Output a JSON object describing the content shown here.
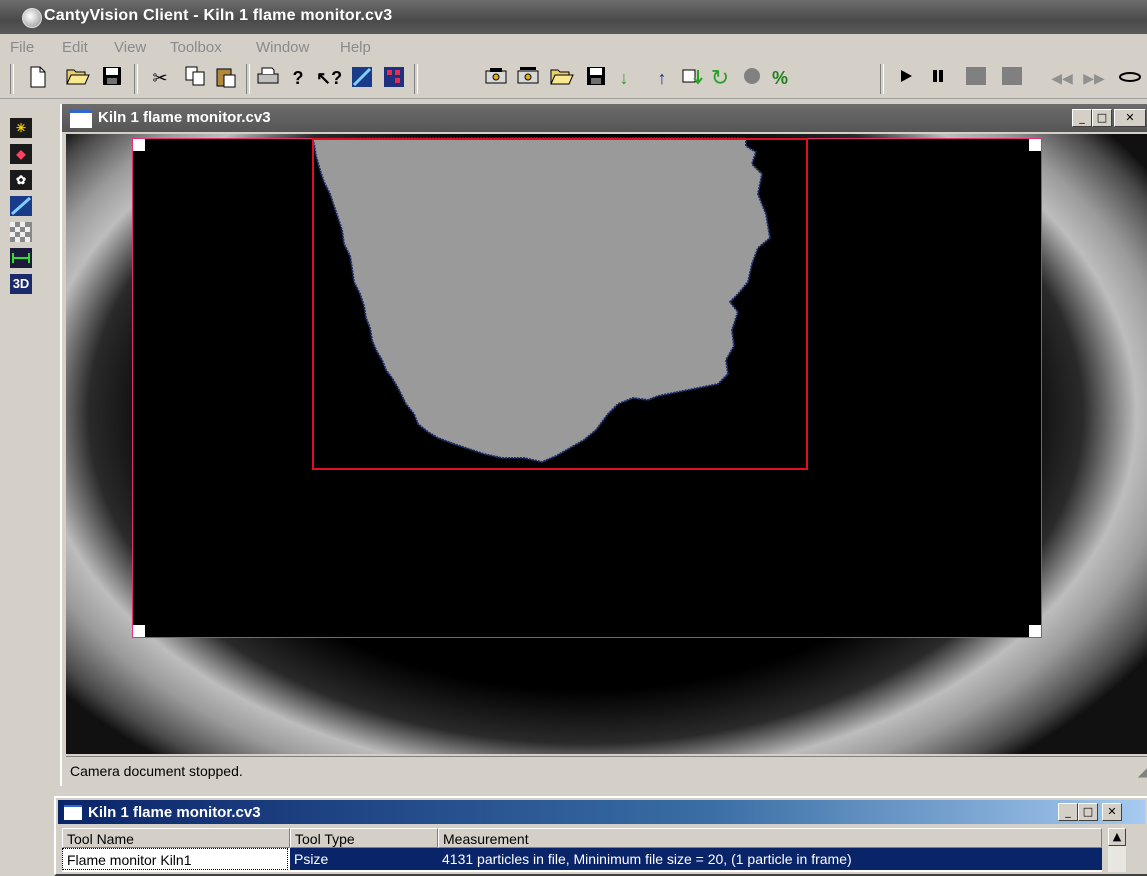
{
  "app": {
    "title": "CantyVision Client - Kiln 1 flame monitor.cv3"
  },
  "menu": [
    "File",
    "Edit",
    "View",
    "Toolbox",
    "Window",
    "Help"
  ],
  "toolbar": {
    "icons": [
      "new-file-icon",
      "open-folder-icon",
      "save-disk-icon",
      "cut-icon",
      "copy-icon",
      "paste-icon",
      "print-icon",
      "help-icon",
      "context-help-icon",
      "wand-icon",
      "pattern-icon",
      "camera-icon",
      "camera-open-icon",
      "open-folder-icon",
      "save-disk-icon",
      "arrow-down-icon",
      "arrow-up-icon",
      "download-icon",
      "refresh-icon",
      "record-icon",
      "percent-icon",
      "play-icon",
      "pause-icon",
      "stop-icon",
      "stop-icon",
      "rewind-icon",
      "fast-forward-icon",
      "loop-icon"
    ],
    "percent_label": "%"
  },
  "left_toolbar": {
    "three_d_label": "3D"
  },
  "document": {
    "title": "Kiln 1 flame monitor.cv3",
    "status": "Camera document stopped."
  },
  "panel": {
    "title": "Kiln 1 flame monitor.cv3",
    "columns": [
      "Tool Name",
      "Tool Type",
      "Measurement"
    ],
    "rows": [
      {
        "tool_name": "Flame monitor Kiln1",
        "tool_type": "Psize",
        "measurement": "4131 particles in file, Mininimum file size = 20, (1 particle in frame)"
      }
    ]
  },
  "colors": {
    "selection": "#0a246a",
    "roi_outer": "#e0307a",
    "roi_inner": "#e01020",
    "flame_fill": "#9a9a9a"
  }
}
